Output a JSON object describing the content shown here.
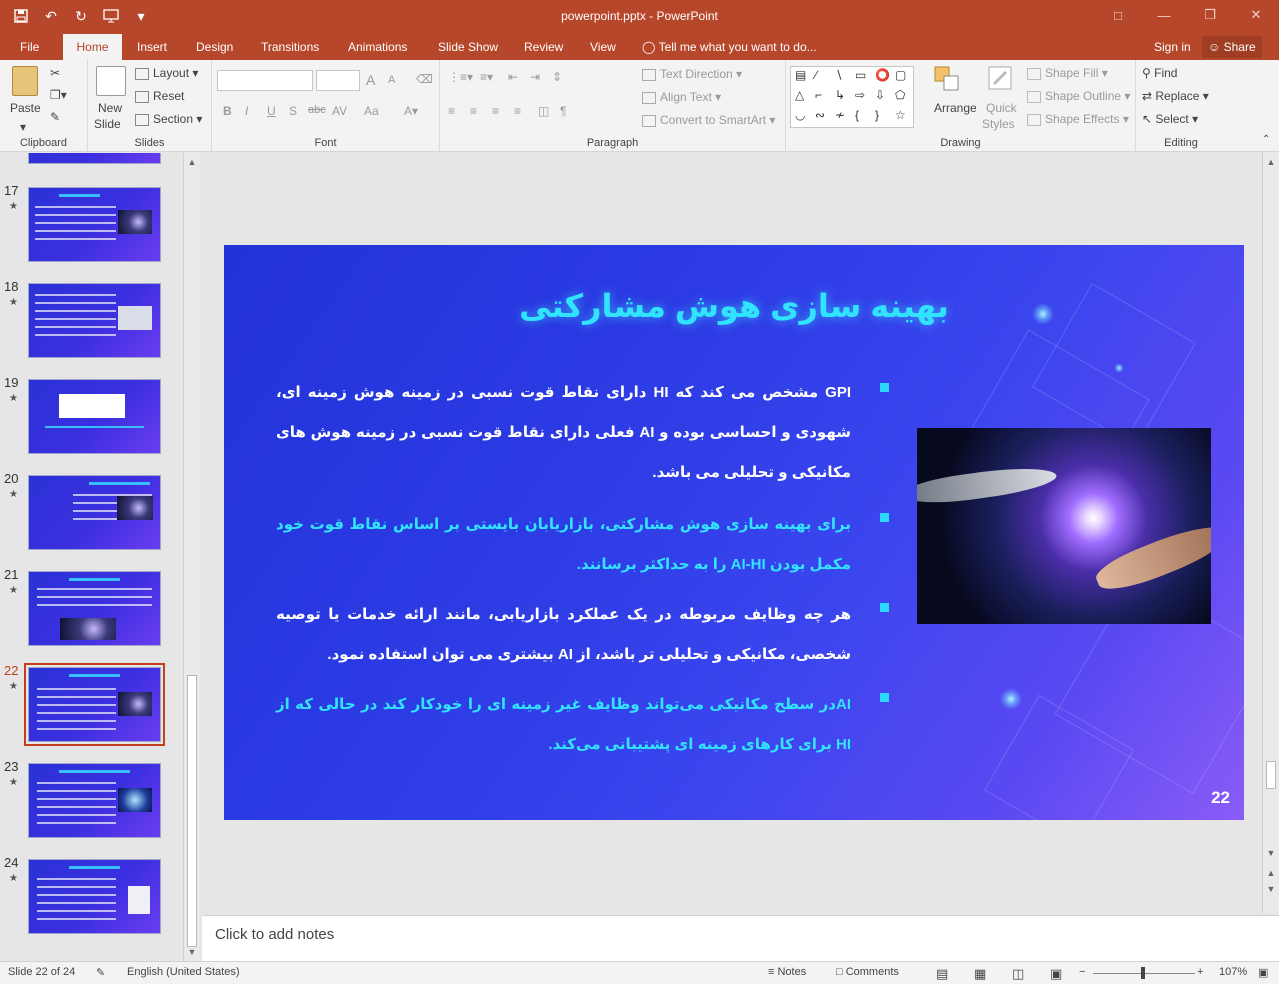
{
  "window": {
    "title": "powerpoint.pptx - PowerPoint",
    "qat": [
      "save-icon",
      "undo-icon",
      "redo-icon",
      "start-presentation-icon",
      "customize-icon"
    ]
  },
  "tabs": [
    "File",
    "Home",
    "Insert",
    "Design",
    "Transitions",
    "Animations",
    "Slide Show",
    "Review",
    "View"
  ],
  "active_tab": "Home",
  "tell_me": "Tell me what you want to do...",
  "sign_in": "Sign in",
  "share": "Share",
  "ribbon": {
    "clipboard": {
      "label": "Clipboard",
      "paste": "Paste"
    },
    "slides": {
      "label": "Slides",
      "new_slide": "New",
      "new_slide2": "Slide",
      "layout": "Layout",
      "reset": "Reset",
      "section": "Section"
    },
    "font": {
      "label": "Font",
      "bold": "B",
      "italic": "I",
      "underline": "U",
      "shadow": "S",
      "strike": "abc",
      "spacing": "AV",
      "case": "Aa",
      "grow": "A",
      "shrink": "A"
    },
    "paragraph": {
      "label": "Paragraph",
      "text_direction": "Text Direction",
      "align_text": "Align Text",
      "convert": "Convert to SmartArt"
    },
    "drawing": {
      "label": "Drawing",
      "arrange": "Arrange",
      "quick": "Quick",
      "styles": "Styles",
      "shape_fill": "Shape Fill",
      "shape_outline": "Shape Outline",
      "shape_effects": "Shape Effects"
    },
    "editing": {
      "label": "Editing",
      "find": "Find",
      "replace": "Replace",
      "select": "Select"
    }
  },
  "thumbnails": [
    {
      "num": "17",
      "active": false
    },
    {
      "num": "18",
      "active": false
    },
    {
      "num": "19",
      "active": false
    },
    {
      "num": "20",
      "active": false
    },
    {
      "num": "21",
      "active": false
    },
    {
      "num": "22",
      "active": true
    },
    {
      "num": "23",
      "active": false
    },
    {
      "num": "24",
      "active": false
    }
  ],
  "slide": {
    "title": "بهینه سازی هوش مشارکتی",
    "bullets": [
      {
        "text": "GPI مشخص می کند که HI دارای نقاط قوت نسبی در زمینه هوش زمینه ای، شهودی و احساسی بوده و AI فعلی دارای نقاط قوت نسبی در زمینه هوش های مکانیکی و تحلیلی می باشد.",
        "color": "white"
      },
      {
        "text": "برای بهینه سازی هوش مشارکتی، بازاریابان بایستی بر اساس نقاط قوت خود مکمل بودن AI-HI را به حداکثر برسانند.",
        "color": "cyan"
      },
      {
        "text": "هر چه وظایف مربوطه در یک عملکرد بازاریابی، مانند ارائه خدمات یا توصیه شخصی، مکانیکی و تحلیلی تر باشد، از AI بیشتری می توان استفاده نمود.",
        "color": "white"
      },
      {
        "text": "AIدر سطح مکانیکی می‌تواند وظایف غیر زمینه ای را خودکار کند در حالی که از HI برای کارهای زمینه ای پشتیبانی می‌کند.",
        "color": "cyan"
      }
    ],
    "number": "22"
  },
  "notes_placeholder": "Click to add notes",
  "status": {
    "slide_info": "Slide 22 of 24",
    "language": "English (United States)",
    "notes": "Notes",
    "comments": "Comments",
    "zoom": "107%"
  },
  "colors": {
    "accent": "#b7472a",
    "slide_title": "#31e3ff",
    "bullet_cyan": "#33e4ff"
  }
}
